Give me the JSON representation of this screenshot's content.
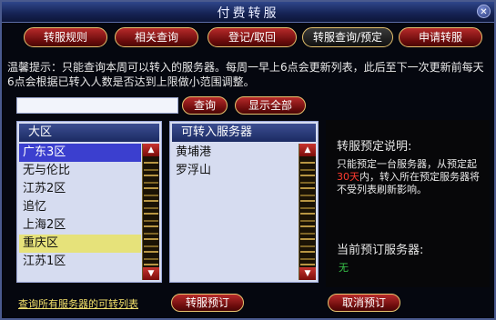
{
  "window": {
    "title": "付费转服"
  },
  "tabs": [
    {
      "label": "转服规则"
    },
    {
      "label": "相关查询"
    },
    {
      "label": "登记/取回"
    },
    {
      "label": "转服查询/预定"
    },
    {
      "label": "申请转服"
    }
  ],
  "notice": "温馨提示：只能查询本周可以转入的服务器。每周一早上6点会更新列表，此后至下一次更新前每天6点会根据已转入人数是否达到上限做小范围调整。",
  "search": {
    "value": "",
    "placeholder": ""
  },
  "buttons": {
    "query": "查询",
    "show_all": "显示全部",
    "transfer_reserve": "转服预订",
    "cancel_reserve": "取消预订"
  },
  "region_panel": {
    "header": "大区",
    "items": [
      "广东3区",
      "无与伦比",
      "江苏2区",
      "追忆",
      "上海2区",
      "重庆区",
      "江苏1区"
    ]
  },
  "server_panel": {
    "header": "可转入服务器",
    "items": [
      "黄埔港",
      "罗浮山"
    ]
  },
  "description": {
    "title": "转服预定说明:",
    "text_part1": "只能预定一台服务器，从预定起",
    "highlight": "30天",
    "text_part2": "内，转入所在预定服务器将不受列表刷新影响。",
    "current_label": "当前预订服务器:",
    "current_value": "无"
  },
  "bottom": {
    "link": "查询所有服务器的可转列表"
  }
}
